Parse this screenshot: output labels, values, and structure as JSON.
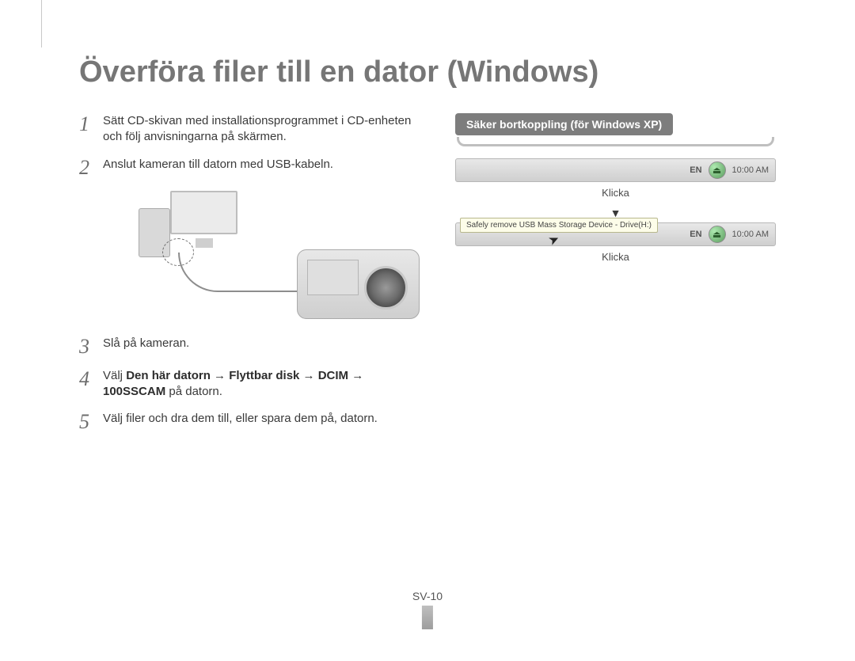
{
  "heading": "Överföra filer till en dator (Windows)",
  "steps": [
    {
      "n": "1",
      "text": "Sätt CD-skivan med installationsprogrammet i CD-enheten och följ anvisningarna på skärmen."
    },
    {
      "n": "2",
      "text": "Anslut kameran till datorn med USB-kabeln."
    },
    {
      "n": "3",
      "text": "Slå på kameran."
    },
    {
      "n": "4",
      "prefix": "Välj ",
      "bold": "Den här datorn → Flyttbar disk → DCIM → 100SSCAM",
      "suffix": " på datorn."
    },
    {
      "n": "5",
      "text": "Välj filer och dra dem till, eller spara dem på, datorn."
    }
  ],
  "sidebar": {
    "pill": "Säker bortkoppling (för Windows XP)",
    "taskbar": {
      "lang": "EN",
      "time": "10:00 AM"
    },
    "click": "Klicka",
    "arrow": "▼",
    "balloon": "Safely remove USB Mass Storage Device - Drive(H:)"
  },
  "pageNumber": "SV-10"
}
